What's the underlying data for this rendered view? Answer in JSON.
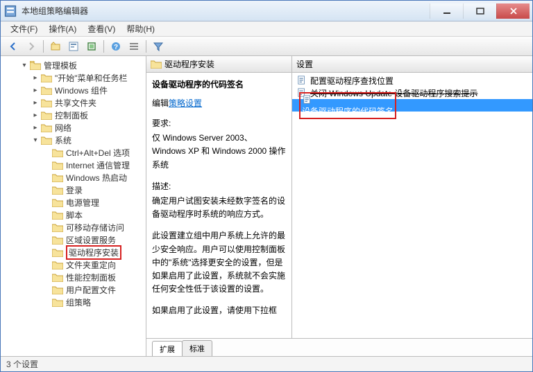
{
  "window": {
    "title": "本地组策略编辑器"
  },
  "menu": {
    "file": "文件(F)",
    "action": "操作(A)",
    "view": "查看(V)",
    "help": "帮助(H)"
  },
  "icons": {
    "back": "back",
    "forward": "forward",
    "up": "up",
    "props": "props",
    "tree": "tree",
    "export": "export",
    "help": "help",
    "filter": "filter"
  },
  "tree": {
    "root_expanded": "管理模板",
    "items": [
      {
        "label": "\"开始\"菜单和任务栏",
        "indent": 1
      },
      {
        "label": "Windows 组件",
        "indent": 1
      },
      {
        "label": "共享文件夹",
        "indent": 1
      },
      {
        "label": "控制面板",
        "indent": 1
      },
      {
        "label": "网络",
        "indent": 1
      },
      {
        "label": "系统",
        "indent": 1,
        "expanded": true
      },
      {
        "label": "Ctrl+Alt+Del 选项",
        "indent": 2
      },
      {
        "label": "Internet 通信管理",
        "indent": 2
      },
      {
        "label": "Windows 热启动",
        "indent": 2
      },
      {
        "label": "登录",
        "indent": 2
      },
      {
        "label": "电源管理",
        "indent": 2
      },
      {
        "label": "脚本",
        "indent": 2
      },
      {
        "label": "可移动存储访问",
        "indent": 2
      },
      {
        "label": "区域设置服务",
        "indent": 2
      },
      {
        "label": "驱动程序安装",
        "indent": 2,
        "highlighted": true
      },
      {
        "label": "文件夹重定向",
        "indent": 2
      },
      {
        "label": "性能控制面板",
        "indent": 2
      },
      {
        "label": "用户配置文件",
        "indent": 2
      },
      {
        "label": "组策略",
        "indent": 2
      }
    ]
  },
  "desc": {
    "header": "驱动程序安装",
    "title": "设备驱动程序的代码签名",
    "edit_prefix": "编辑",
    "edit_link": "策略设置",
    "req_label": "要求:",
    "req_text": "仅 Windows Server 2003、Windows XP 和 Windows 2000 操作系统",
    "desc_label": "描述:",
    "desc1": "确定用户试图安装未经数字签名的设备驱动程序时系统的响应方式。",
    "desc2": "此设置建立组中用户系统上允许的最少安全响应。用户可以使用控制面板中的\"系统\"选择更安全的设置，但是如果启用了此设置，系统就不会实施任何安全性低于该设置的设置。",
    "desc3": "如果启用了此设置，请使用下拉框"
  },
  "items": {
    "header": "设置",
    "rows": [
      {
        "label": "配置驱动程序查找位置",
        "struck": false,
        "selected": false
      },
      {
        "label": "关闭 Windows Update 设备驱动程序搜索提示",
        "struck": true,
        "selected": false
      },
      {
        "label": "设备驱动程序的代码签名",
        "struck": false,
        "selected": true,
        "highlighted": true
      }
    ]
  },
  "tabs": {
    "extended": "扩展",
    "standard": "标准"
  },
  "status": "3 个设置"
}
